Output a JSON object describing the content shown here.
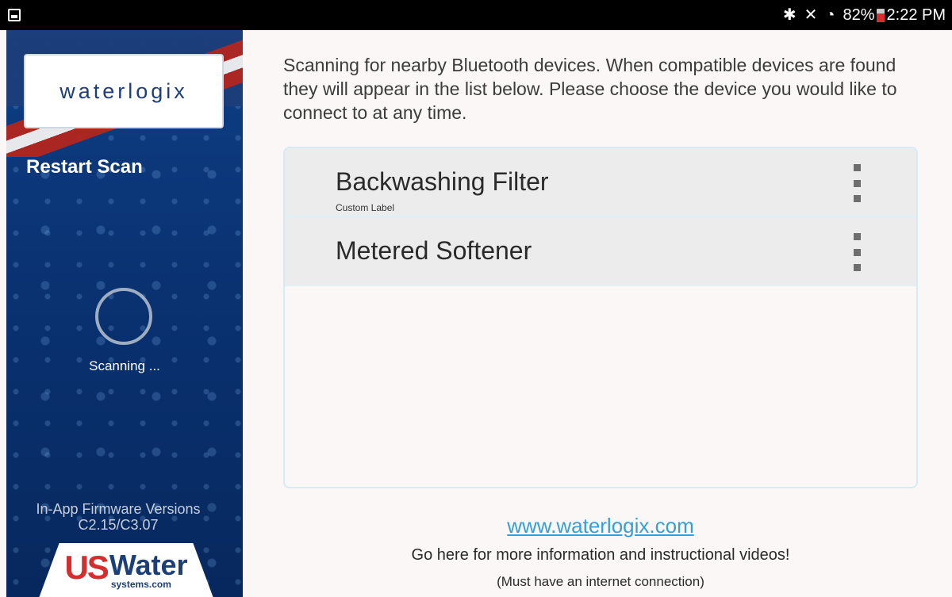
{
  "status_bar": {
    "left_icon": "gallery-icon",
    "icons": [
      "bluetooth-icon",
      "mute-icon",
      "wifi-icon",
      "battery-icon"
    ],
    "battery": "82%",
    "time": "2:22 PM"
  },
  "sidebar": {
    "logo": "waterlogix",
    "restart_scan": "Restart Scan",
    "scanning": "Scanning ...",
    "firmware_title": "In-App Firmware Versions",
    "firmware_versions": "C2.15/C3.07",
    "brand_us": "US",
    "brand_water": "Water",
    "brand_domain": "systems.com"
  },
  "main": {
    "intro": "Scanning for nearby Bluetooth devices. When compatible devices are found they will appear in the list below. Please choose the device you would like to connect to at any time.",
    "devices": [
      {
        "name": "Backwashing Filter",
        "label": "Custom Label"
      },
      {
        "name": "Metered Softener",
        "label": ""
      }
    ],
    "link": "www.waterlogix.com",
    "info": "Go here for more information and instructional videos!",
    "note": "(Must have an internet connection)"
  },
  "colors": {
    "link": "#35a0d8",
    "sidebar": "#0a3373",
    "status_bar": "#000000"
  }
}
